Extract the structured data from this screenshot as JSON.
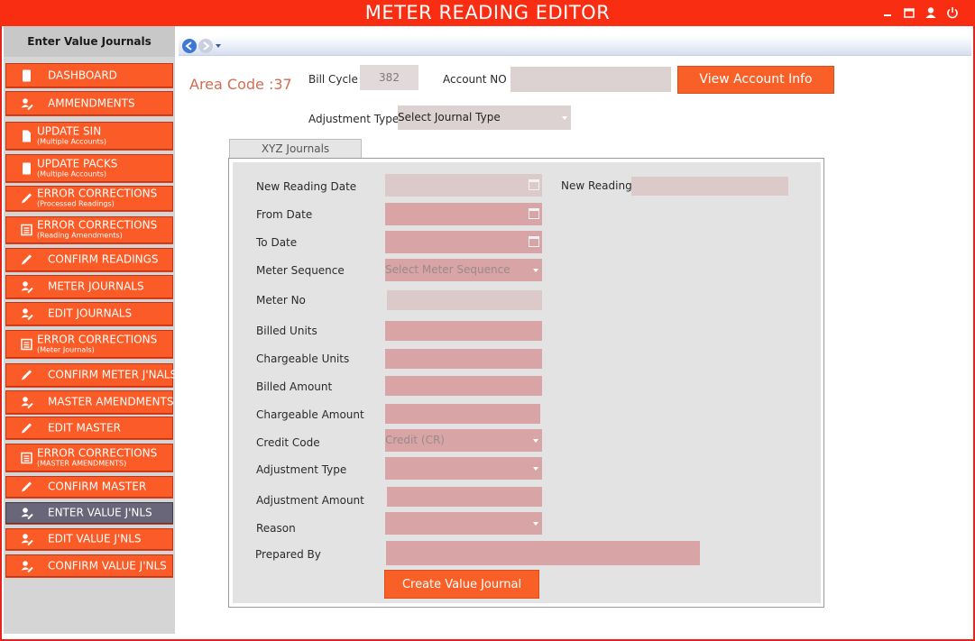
{
  "app": {
    "title": "METER READING EDITOR"
  },
  "window_controls": [
    {
      "name": "minimize-icon",
      "glyph": "‒"
    },
    {
      "name": "maximize-icon",
      "glyph": "□"
    },
    {
      "name": "user-icon",
      "glyph": "●"
    },
    {
      "name": "power-icon",
      "glyph": "⏻"
    }
  ],
  "sidebar": {
    "header": "Enter Value Journals",
    "items": [
      {
        "label": "DASHBOARD",
        "sub": "",
        "icon": "document-icon"
      },
      {
        "label": "AMMENDMENTS",
        "sub": "",
        "icon": "user-edit-icon"
      },
      {
        "label": "UPDATE SIN",
        "sub": "(Multiple Accounts)",
        "icon": "file-icon"
      },
      {
        "label": "UPDATE PACKS",
        "sub": "(Multiple Accounts)",
        "icon": "document-icon"
      },
      {
        "label": "ERROR CORRECTIONS",
        "sub": "(Processed Readings)",
        "icon": "pen-icon"
      },
      {
        "label": "ERROR CORRECTIONS",
        "sub": "(Reading Amendments)",
        "icon": "list-icon"
      },
      {
        "label": "CONFIRM READINGS",
        "sub": "",
        "icon": "pen-icon"
      },
      {
        "label": "METER JOURNALS",
        "sub": "",
        "icon": "user-edit-icon"
      },
      {
        "label": "EDIT JOURNALS",
        "sub": "",
        "icon": "user-edit-icon"
      },
      {
        "label": "ERROR CORRECTIONS",
        "sub": "(Meter Journals)",
        "icon": "list-icon"
      },
      {
        "label": "CONFIRM METER J'NALS",
        "sub": "",
        "icon": "pen-icon"
      },
      {
        "label": "MASTER AMENDMENTS",
        "sub": "",
        "icon": "user-edit-icon"
      },
      {
        "label": "EDIT MASTER",
        "sub": "",
        "icon": "pen-icon"
      },
      {
        "label": "ERROR CORRECTIONS",
        "sub": "(MASTER AMENDMENTS)",
        "icon": "list-icon"
      },
      {
        "label": "CONFIRM MASTER",
        "sub": "",
        "icon": "pen-icon"
      },
      {
        "label": "ENTER VALUE J'NLS",
        "sub": "",
        "icon": "user-edit-icon",
        "active": true
      },
      {
        "label": "EDIT VALUE J'NLS",
        "sub": "",
        "icon": "user-edit-icon"
      },
      {
        "label": "CONFIRM VALUE J'NLS",
        "sub": "",
        "icon": "user-edit-icon"
      }
    ]
  },
  "header": {
    "area_code": "Area Code :37",
    "bill_cycle_label": "Bill Cycle",
    "bill_cycle_value": "382",
    "account_no_label": "Account NO",
    "account_no_value": "",
    "view_account_button": "View Account Info",
    "adjustment_type_label": "Adjustment Type",
    "adjustment_type_value": "Select Journal Type"
  },
  "tab": {
    "label": "XYZ Journals"
  },
  "form": {
    "new_reading_date_label": "New Reading Date",
    "new_reading_label": "New Reading",
    "from_date_label": "From Date",
    "to_date_label": "To Date",
    "meter_sequence_label": "Meter Sequence",
    "meter_sequence_placeholder": "Select Meter Sequence",
    "meter_no_label": "Meter No",
    "billed_units_label": "Billed Units",
    "chargeable_units_label": "Chargeable Units",
    "billed_amount_label": "Billed Amount",
    "chargeable_amount_label": "Chargeable Amount",
    "credit_code_label": "Credit Code",
    "credit_code_value": "Credit (CR)",
    "adjustment_type_label": "Adjustment Type",
    "adjustment_amount_label": "Adjustment Amount",
    "reason_label": "Reason",
    "prepared_by_label": "Prepared By",
    "create_button": "Create Value Journal"
  },
  "colors": {
    "brand": "#f92d12",
    "button": "#f96027",
    "active_nav": "#6a6679",
    "field": "#d8a4a5"
  }
}
